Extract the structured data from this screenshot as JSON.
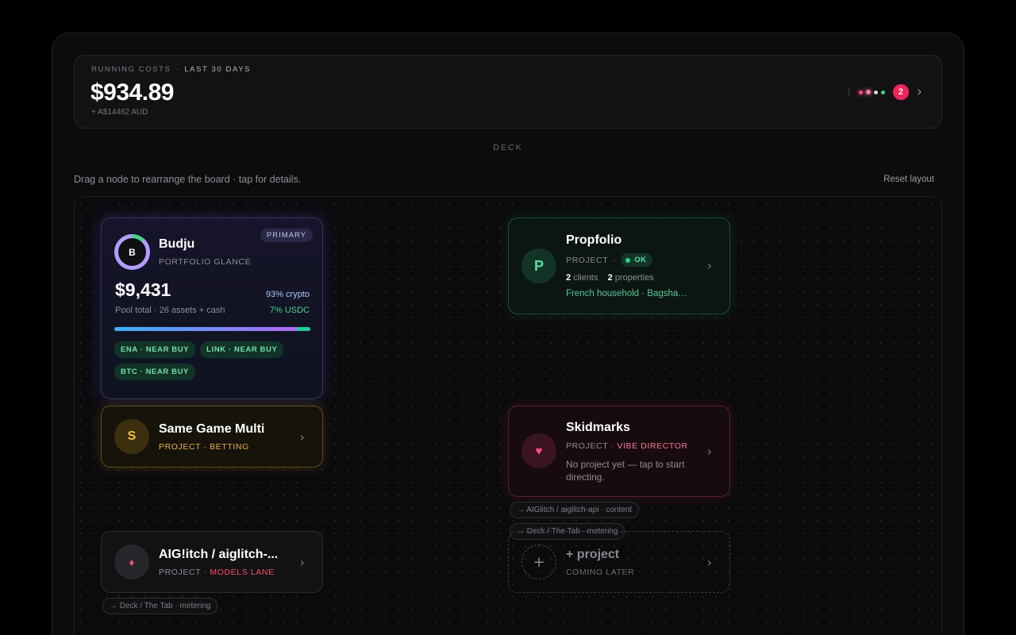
{
  "costs": {
    "label": "RUNNING COSTS",
    "label_sep": "·",
    "period": "LAST 30 DAYS",
    "amount": "$934.89",
    "sub": "+ A$14462 AUD",
    "alert_count": "2",
    "dot_colors": [
      "#ff4f7b",
      "#ff7aa0",
      "#d9d9de",
      "#46d38a"
    ]
  },
  "deck": {
    "title": "DECK",
    "hint": "Drag a node to rearrange the board · tap for details.",
    "reset_label": "Reset layout"
  },
  "budju": {
    "initial": "B",
    "title": "Budju",
    "subtitle": "PORTFOLIO GLANCE",
    "badge": "PRIMARY",
    "amount": "$9,431",
    "pool": "Pool total · 26 assets + cash",
    "crypto": "93% crypto",
    "usdc": "7% USDC",
    "crypto_pct": 93,
    "usdc_pct": 7,
    "chips": [
      "ENA · NEAR BUY",
      "LINK · NEAR BUY",
      "BTC · NEAR BUY"
    ]
  },
  "propfolio": {
    "initial": "P",
    "title": "Propfolio",
    "kind": "PROJECT",
    "sep": "·",
    "status": "OK",
    "clients_count": "2",
    "clients_label": "clients",
    "properties_count": "2",
    "properties_label": "properties",
    "desc": "French household · Bagsha…"
  },
  "sgm": {
    "initial": "S",
    "title": "Same Game Multi",
    "subtitle": "PROJECT · BETTING"
  },
  "skidmarks": {
    "icon": "♥",
    "title": "Skidmarks",
    "kind": "PROJECT",
    "sep": "·",
    "role": "VIBE DIRECTOR",
    "desc": "No project yet — tap to start directing.",
    "tags": [
      "→ AIGlitch / aiglitch-api · content",
      "→ Deck / The Tab · metering"
    ]
  },
  "aiglitch": {
    "icon": "♦",
    "title": "AIG!itch / aiglitch-...",
    "kind": "PROJECT",
    "sep": "·",
    "lane": "MODELS LANE",
    "tag": "→ Deck / The Tab · metering"
  },
  "new_project": {
    "icon": "+",
    "title": "+ project",
    "subtitle": "COMING LATER"
  },
  "chevron": "›"
}
